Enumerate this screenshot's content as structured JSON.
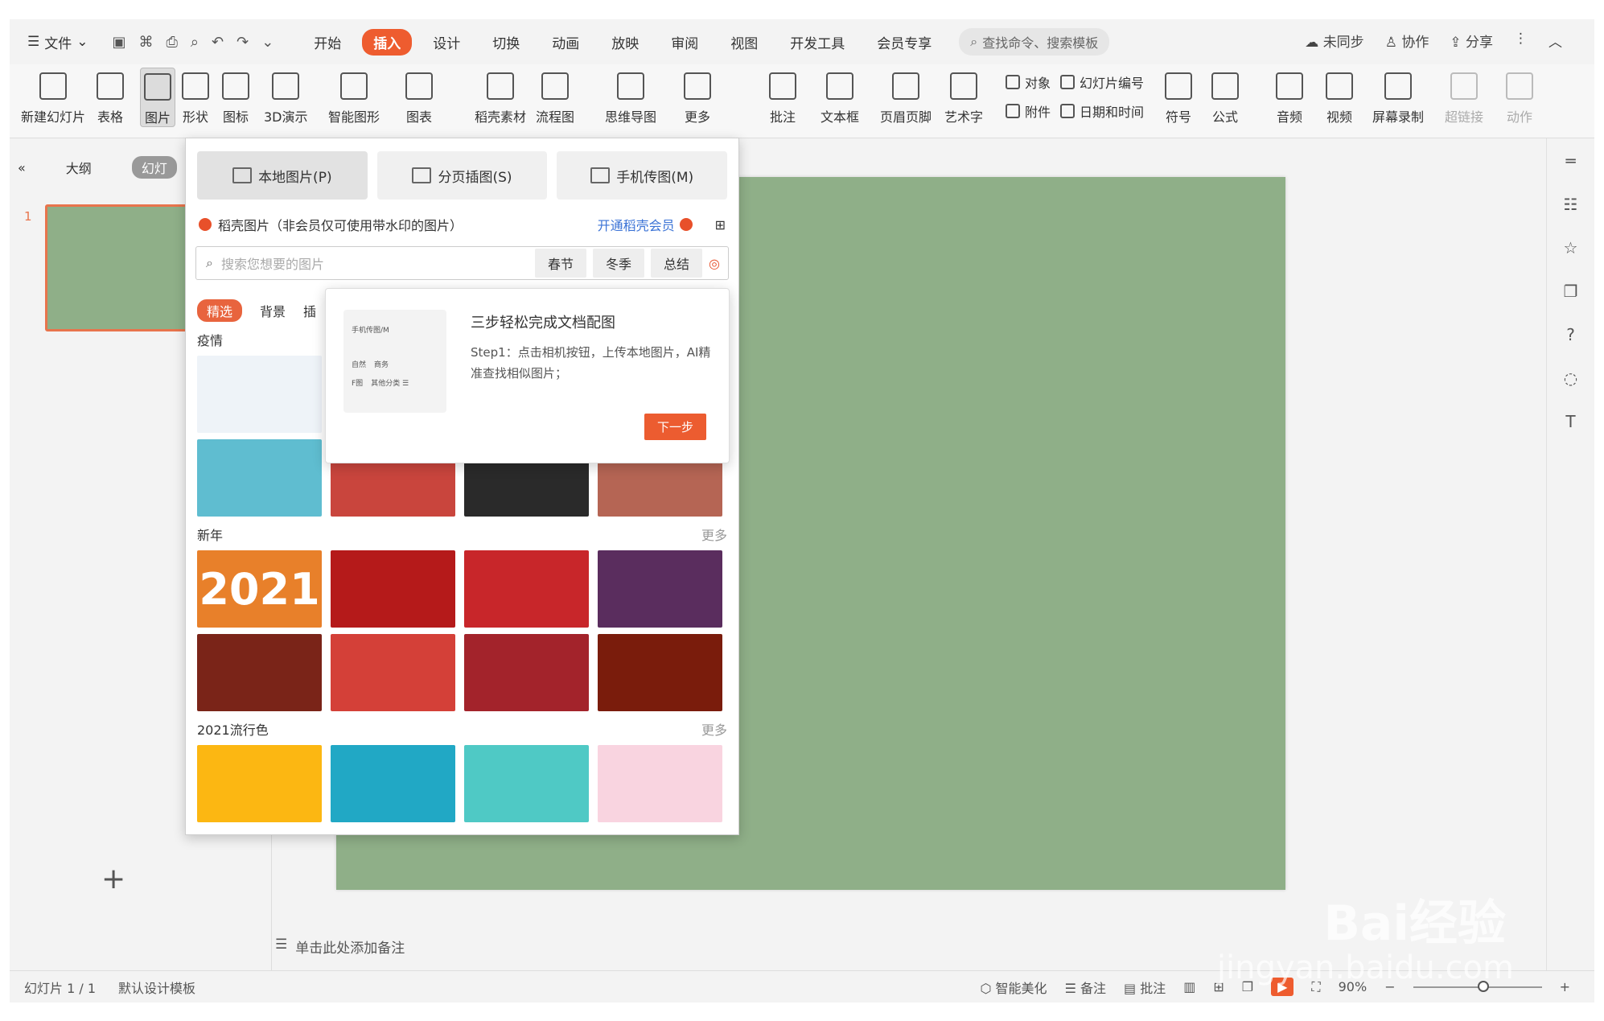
{
  "menubar": {
    "file_label": "文件",
    "tabs": [
      "开始",
      "插入",
      "设计",
      "切换",
      "动画",
      "放映",
      "审阅",
      "视图",
      "开发工具",
      "会员专享"
    ],
    "active_tab": "插入",
    "search_placeholder": "查找命令、搜索模板",
    "right": [
      "未同步",
      "协作",
      "分享"
    ]
  },
  "ribbon": {
    "buttons": [
      "新建幻灯片",
      "表格",
      "图片",
      "形状",
      "图标",
      "3D演示",
      "智能图形",
      "图表",
      "稻壳素材",
      "流程图",
      "思维导图",
      "更多",
      "批注",
      "文本框",
      "页眉页脚",
      "艺术字"
    ],
    "small": [
      "对象",
      "幻灯片编号",
      "附件",
      "日期和时间"
    ],
    "buttons2": [
      "符号",
      "公式",
      "音频",
      "视频",
      "屏幕录制",
      "超链接",
      "动作"
    ]
  },
  "leftpanel": {
    "outline": "大纲",
    "slides": "幻灯",
    "slide_number": "1",
    "add": "+"
  },
  "notes": "单击此处添加备注",
  "status": {
    "slide_info": "幻灯片 1 / 1",
    "template": "默认设计模板",
    "beautify": "智能美化",
    "notes": "备注",
    "comments": "批注",
    "zoom": "90%"
  },
  "dropdown": {
    "tabs": [
      "本地图片(P)",
      "分页插图(S)",
      "手机传图(M)"
    ],
    "docer_label": "稻壳图片（非会员仅可使用带水印的图片）",
    "vip_link": "开通稻壳会员",
    "search_placeholder": "搜索您想要的图片",
    "search_tags": [
      "春节",
      "冬季",
      "总结"
    ],
    "categories": [
      "精选",
      "背景",
      "插"
    ],
    "sections": [
      {
        "title": "疫情",
        "more": ""
      },
      {
        "title": "新年",
        "more": "更多"
      },
      {
        "title": "2021流行色",
        "more": "更多"
      }
    ],
    "year_label": "2021"
  },
  "tooltip": {
    "title": "三步轻松完成文档配图",
    "body": "Step1：点击相机按钮，上传本地图片，AI精准查找相似图片；",
    "button": "下一步",
    "illus_labels": [
      "手机传图/M",
      "自然",
      "商务",
      "F图",
      "其他分类 ☰"
    ]
  },
  "watermark": {
    "brand": "Bai经验",
    "url": "jingyan.baidu.com"
  }
}
